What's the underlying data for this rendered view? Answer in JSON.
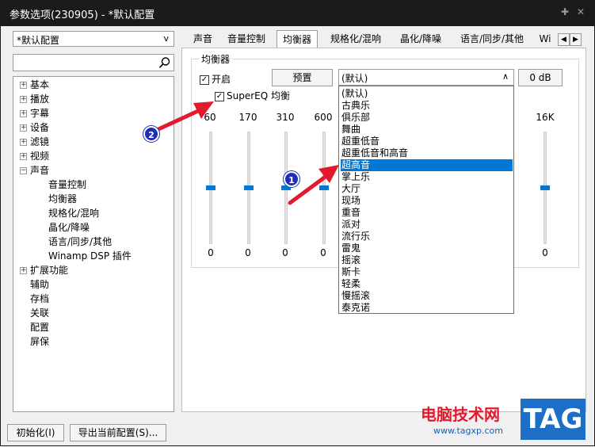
{
  "window": {
    "title": "参数选项(230905) - *默认配置"
  },
  "left": {
    "preset_value": "*默认配置",
    "search_placeholder": "",
    "tree": [
      {
        "label": "基本",
        "expander": "+",
        "indent": 0
      },
      {
        "label": "播放",
        "expander": "+",
        "indent": 0
      },
      {
        "label": "字幕",
        "expander": "+",
        "indent": 0
      },
      {
        "label": "设备",
        "expander": "+",
        "indent": 0
      },
      {
        "label": "滤镜",
        "expander": "+",
        "indent": 0
      },
      {
        "label": "视频",
        "expander": "+",
        "indent": 0
      },
      {
        "label": "声音",
        "expander": "−",
        "indent": 0
      },
      {
        "label": "音量控制",
        "expander": "",
        "indent": 1
      },
      {
        "label": "均衡器",
        "expander": "",
        "indent": 1
      },
      {
        "label": "规格化/混响",
        "expander": "",
        "indent": 1
      },
      {
        "label": "晶化/降噪",
        "expander": "",
        "indent": 1
      },
      {
        "label": "语言/同步/其他",
        "expander": "",
        "indent": 1
      },
      {
        "label": "Winamp DSP 插件",
        "expander": "",
        "indent": 1
      },
      {
        "label": "扩展功能",
        "expander": "+",
        "indent": 0
      },
      {
        "label": "辅助",
        "expander": "",
        "indent": 0
      },
      {
        "label": "存档",
        "expander": "",
        "indent": 0
      },
      {
        "label": "关联",
        "expander": "",
        "indent": 0
      },
      {
        "label": "配置",
        "expander": "",
        "indent": 0
      },
      {
        "label": "屏保",
        "expander": "",
        "indent": 0
      }
    ]
  },
  "buttons": {
    "init": "初始化(I)",
    "export": "导出当前配置(S)..."
  },
  "tabs": [
    "声音",
    "音量控制",
    "均衡器",
    "规格化/混响",
    "晶化/降噪",
    "语言/同步/其他",
    "Wi"
  ],
  "eq": {
    "group_title": "均衡器",
    "enable_label": "开启",
    "superEQ_label": "SuperEQ 均衡",
    "preset_button": "预置",
    "combo_value": "(默认)",
    "db_value": "0 dB",
    "freqs": [
      "60",
      "170",
      "310",
      "600",
      "16K"
    ],
    "values": [
      "0",
      "0",
      "0",
      "0",
      "0"
    ]
  },
  "dropdown": {
    "items": [
      "(默认)",
      "古典乐",
      "俱乐部",
      "舞曲",
      "超重低音",
      "超重低音和高音",
      "超高音",
      "掌上乐",
      "大厅",
      "现场",
      "重音",
      "派对",
      "流行乐",
      "雷鬼",
      "摇滚",
      "斯卡",
      "轻柔",
      "慢摇滚",
      "泰克诺"
    ],
    "highlighted": "超高音"
  },
  "annotations": {
    "one": "1",
    "two": "2"
  },
  "watermark": {
    "text": "电脑技术网",
    "url": "www.tagxp.com",
    "tag": "TAG"
  },
  "colors": {
    "accent": "#0078d7",
    "arrow": "#e3192d",
    "badge": "#1d2fb8"
  }
}
